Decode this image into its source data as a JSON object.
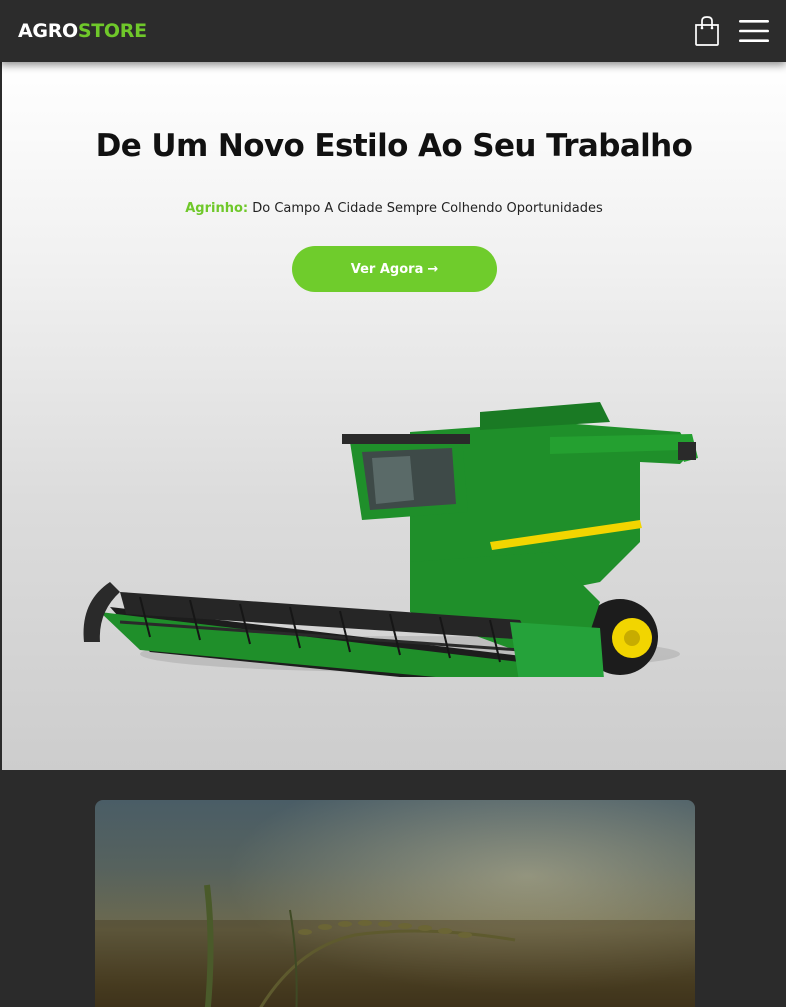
{
  "header": {
    "logo_part1": "AGRO",
    "logo_part2": "STORE",
    "cart_icon": "shopping-bag-icon",
    "menu_icon": "hamburger-menu-icon"
  },
  "hero": {
    "title": "De Um Novo Estilo Ao Seu Trabalho",
    "subtitle_highlight": "Agrinho:",
    "subtitle_text": " Do Campo A Cidade Sempre Colhendo Oportunidades",
    "cta_label": "Ver Agora",
    "cta_arrow": "→",
    "image_label": "combine-harvester"
  },
  "colors": {
    "accent": "#6fc82a",
    "header_bg": "#2c2c2c",
    "machine_green": "#1f8f2a",
    "machine_yellow": "#f2d500"
  }
}
